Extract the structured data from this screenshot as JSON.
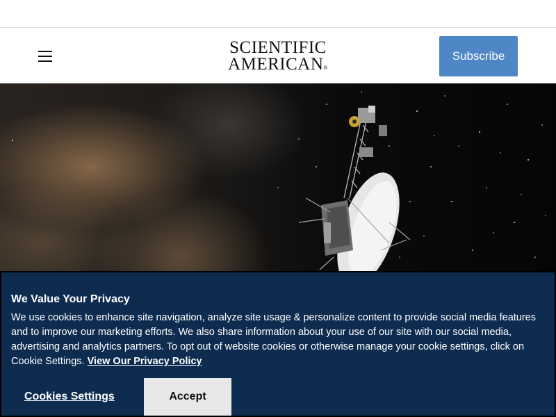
{
  "header": {
    "logo_line1": "SCIENTIFIC",
    "logo_line2": "AMERICAN",
    "logo_mark": "®",
    "subscribe_label": "Subscribe"
  },
  "icons": {
    "menu": "hamburger-menu-icon"
  },
  "colors": {
    "subscribe_bg": "#4f86c6",
    "cookie_bg": "#0e2c50",
    "accept_bg": "#e8e8e8"
  },
  "cookie_banner": {
    "title": "We Value Your Privacy",
    "body": "We use cookies to enhance site navigation, analyze site usage & personalize content to provide social media features and to improve our marketing efforts. We also share information about your use of our site with our social media, advertising and analytics partners. To opt out of website cookies or otherwise manage your cookie settings, click on Cookie Settings. ",
    "policy_link": "View Our Privacy Policy",
    "settings_label": "Cookies Settings",
    "accept_label": "Accept"
  }
}
